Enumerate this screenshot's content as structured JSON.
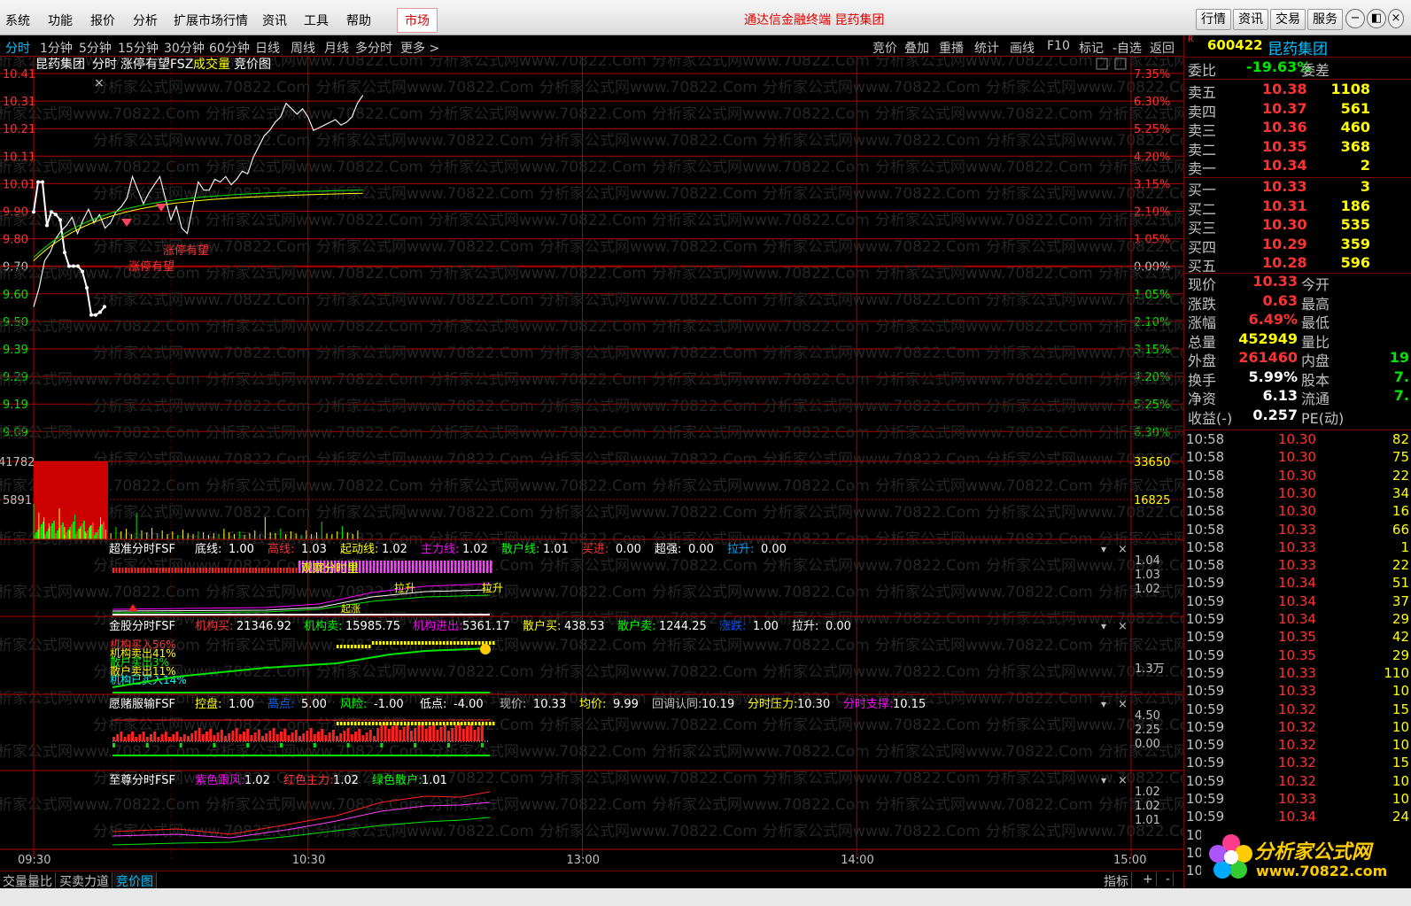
{
  "menu": [
    "系统",
    "功能",
    "报价",
    "分析",
    "扩展市场行情",
    "资讯",
    "工具",
    "帮助"
  ],
  "menu_market": "市场",
  "app_title": "通达信金融终端  昆药集团",
  "right_buttons": [
    "行情",
    "资讯",
    "交易",
    "服务"
  ],
  "window_buttons": [
    "minimize-icon",
    "restore-icon",
    "close-icon"
  ],
  "periods": [
    "分时",
    "1分钟",
    "5分钟",
    "15分钟",
    "30分钟",
    "60分钟",
    "日线",
    "周线",
    "月线",
    "多分时",
    "更多 >"
  ],
  "tools": [
    "竞价",
    "叠加",
    "重播",
    "统计",
    "画线",
    "F10",
    "标记",
    "-自选",
    "返回"
  ],
  "main_legend": {
    "stock": "昆药集团",
    "mode": "分时",
    "ind": "涨停有望FSZ",
    "vol": "成交量",
    "auction": "竞价图"
  },
  "price_labels": [
    "10.41",
    "10.31",
    "10.21",
    "10.11",
    "10.01",
    "9.90",
    "9.80",
    "9.70",
    "9.60",
    "9.50",
    "9.39",
    "9.29",
    "9.19",
    "9.09"
  ],
  "pct_labels": [
    "7.35%",
    "6.30%",
    "5.25%",
    "4.20%",
    "3.15%",
    "2.10%",
    "1.05%",
    "0.00%",
    "1.05%",
    "2.10%",
    "3.15%",
    "4.20%",
    "5.25%",
    "6.30%"
  ],
  "annot": [
    "涨停有望",
    "涨停有望"
  ],
  "vol_left": [
    "41782",
    "5891"
  ],
  "vol_right": [
    "33650",
    "16825"
  ],
  "p1": {
    "name": "超准分时FSF",
    "items": [
      [
        "底线: ",
        "1.00"
      ],
      [
        "高线: ",
        "1.03"
      ],
      [
        "起动线: ",
        "1.02"
      ],
      [
        "主力线: ",
        "1.02"
      ],
      [
        "散户线: ",
        "1.01"
      ],
      [
        "买进: ",
        "0.00"
      ],
      [
        "超强: ",
        "0.00"
      ],
      [
        "拉升: ",
        "0.00"
      ]
    ],
    "axis": [
      "1.04",
      "1.03",
      "1.02"
    ],
    "labels": [
      "观察分时里",
      "拉升",
      "拉升",
      "起涨"
    ]
  },
  "p2": {
    "name": "金股分时FSF",
    "items": [
      [
        "机构买: ",
        "21346.92"
      ],
      [
        "机构卖: ",
        "15985.75"
      ],
      [
        "机构进出: ",
        "5361.17"
      ],
      [
        "散户买: ",
        "438.53"
      ],
      [
        "散户卖: ",
        "1244.25"
      ],
      [
        "涨跌: ",
        "1.00"
      ],
      [
        "拉升: ",
        "0.00"
      ]
    ],
    "axis": [
      "1.3万"
    ],
    "left_stats": [
      "机构买入56%",
      "机构卖出41%",
      "散户买出3%",
      "散户卖出11%",
      "机构已买入14%"
    ]
  },
  "p3": {
    "name": "愿赌服输FSF",
    "items": [
      [
        "控盘: ",
        "1.00"
      ],
      [
        "高点: ",
        "5.00"
      ],
      [
        "风险: ",
        "-1.00"
      ],
      [
        "低点: ",
        "-4.00"
      ],
      [
        "现价: ",
        "10.33"
      ],
      [
        "均价: ",
        "9.99"
      ],
      [
        "回调认同: ",
        "10.19"
      ],
      [
        "分时压力: ",
        "10.30"
      ],
      [
        "分时支撑: ",
        "10.15"
      ]
    ],
    "axis": [
      "4.50",
      "2.25",
      "0.00"
    ]
  },
  "p4": {
    "name": "至尊分时FSF",
    "items": [
      [
        "紫色跟风: ",
        "1.02"
      ],
      [
        "红色主力: ",
        "1.02"
      ],
      [
        "绿色散户: ",
        "1.01"
      ]
    ],
    "axis": [
      "1.02",
      "1.02",
      "1.01"
    ]
  },
  "times": [
    "09:30",
    "10:30",
    "13:00",
    "14:00",
    "15:00"
  ],
  "status_tabs": [
    "交量",
    "量比",
    "买卖力道",
    "竞价图"
  ],
  "status_right": [
    "指标",
    "+",
    "-"
  ],
  "quote": {
    "code": "600422",
    "name": "昆药集团",
    "wb_label": "委比",
    "wb": "-19.63%",
    "wc_label": "委差",
    "sell": [
      [
        "卖五",
        "10.38",
        "1108"
      ],
      [
        "卖四",
        "10.37",
        "561"
      ],
      [
        "卖三",
        "10.36",
        "460"
      ],
      [
        "卖二",
        "10.35",
        "368"
      ],
      [
        "卖一",
        "10.34",
        "2"
      ]
    ],
    "buy": [
      [
        "买一",
        "10.33",
        "3"
      ],
      [
        "买二",
        "10.31",
        "186"
      ],
      [
        "买三",
        "10.30",
        "535"
      ],
      [
        "买四",
        "10.29",
        "359"
      ],
      [
        "买五",
        "10.28",
        "596"
      ]
    ],
    "stats": [
      [
        "现价",
        "10.33",
        "今开",
        ""
      ],
      [
        "涨跌",
        "0.63",
        "最高",
        ""
      ],
      [
        "涨幅",
        "6.49%",
        "最低",
        ""
      ],
      [
        "总量",
        "452949",
        "量比",
        ""
      ],
      [
        "外盘",
        "261460",
        "内盘",
        "19"
      ],
      [
        "换手",
        "5.99%",
        "股本",
        "7."
      ],
      [
        "净资",
        "6.13",
        "流通",
        "7."
      ],
      [
        "收益(-)",
        "0.257",
        "PE(动)",
        ""
      ]
    ],
    "ticks": [
      [
        "10:58",
        "10.30",
        "82"
      ],
      [
        "10:58",
        "10.30",
        "75"
      ],
      [
        "10:58",
        "10.30",
        "22"
      ],
      [
        "10:58",
        "10.30",
        "34"
      ],
      [
        "10:58",
        "10.30",
        "16"
      ],
      [
        "10:58",
        "10.33",
        "66"
      ],
      [
        "10:58",
        "10.33",
        "1"
      ],
      [
        "10:58",
        "10.33",
        "22"
      ],
      [
        "10:59",
        "10.34",
        "51"
      ],
      [
        "10:59",
        "10.34",
        "37"
      ],
      [
        "10:59",
        "10.34",
        "29"
      ],
      [
        "10:59",
        "10.35",
        "42"
      ],
      [
        "10:59",
        "10.35",
        "29"
      ],
      [
        "10:59",
        "10.33",
        "110"
      ],
      [
        "10:59",
        "10.33",
        "10"
      ],
      [
        "10:59",
        "10.32",
        "15"
      ],
      [
        "10:59",
        "10.32",
        "10"
      ],
      [
        "10:59",
        "10.32",
        "10"
      ],
      [
        "10:59",
        "10.32",
        "15"
      ],
      [
        "10:59",
        "10.32",
        "10"
      ],
      [
        "10:59",
        "10.33",
        "10"
      ],
      [
        "10:59",
        "10.34",
        "24"
      ],
      [
        "10:59",
        "10.34",
        ""
      ],
      [
        "10:",
        "",
        " "
      ],
      [
        "10:",
        "",
        " "
      ]
    ]
  },
  "logo": {
    "text": "分析家公式网",
    "url": "www.70822.com"
  },
  "watermark": "分析家公式网www.70822.Com",
  "colors": {
    "up": "#ff3232",
    "down": "#00e600",
    "grid": "#b00000",
    "bg": "#000000"
  }
}
